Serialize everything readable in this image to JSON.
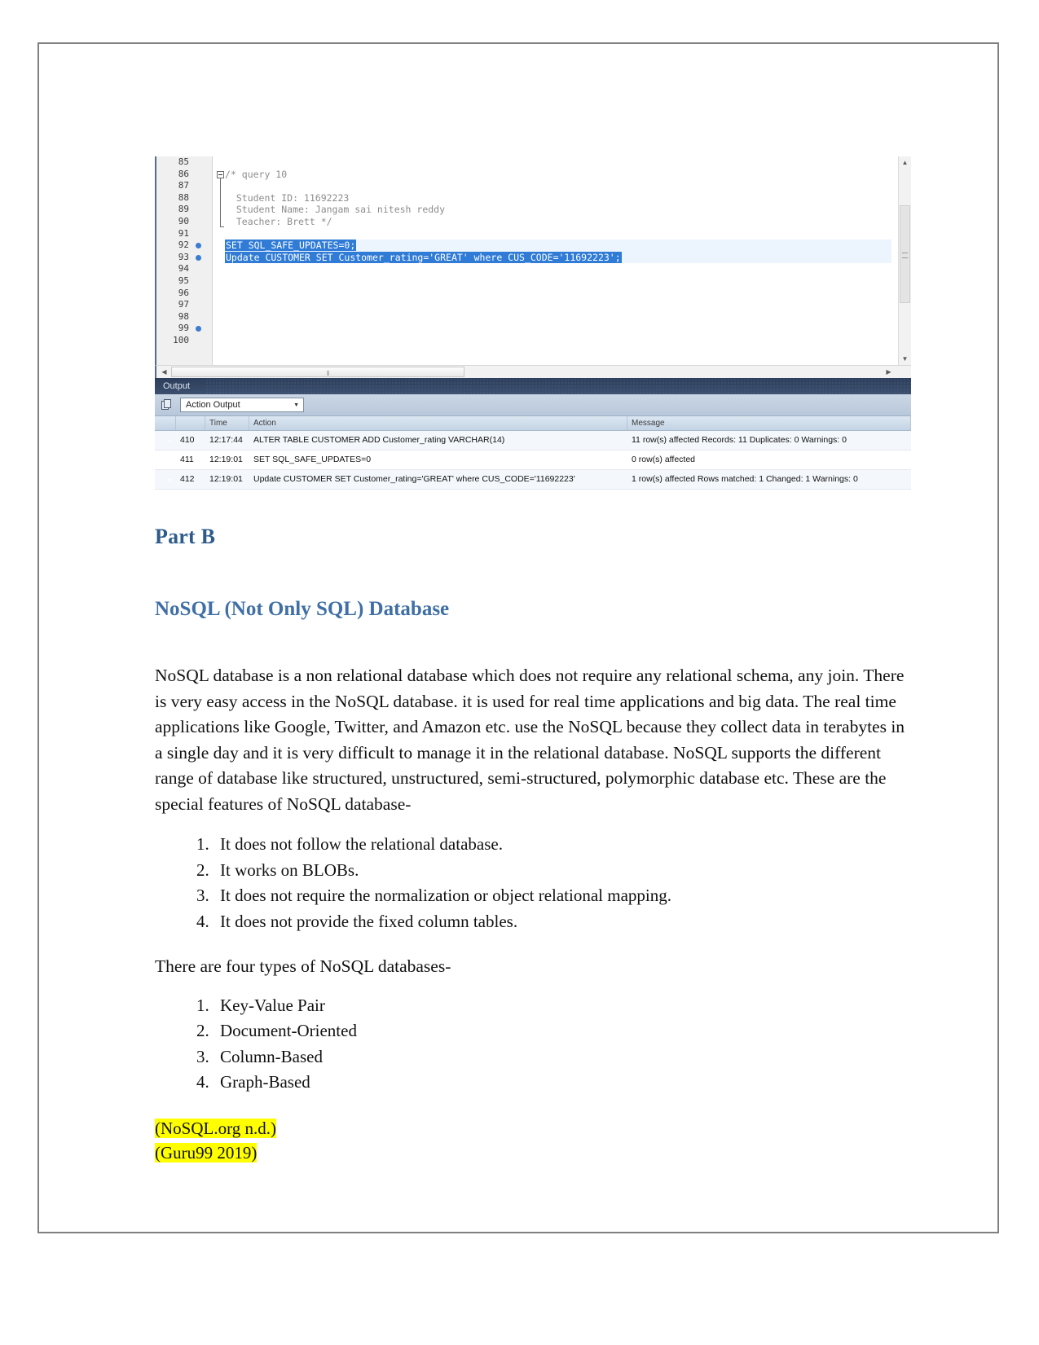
{
  "workbench": {
    "editor": {
      "lines": [
        {
          "num": "85",
          "text": "",
          "bp": false,
          "sel": false
        },
        {
          "num": "86",
          "text": "/* query 10",
          "bp": false,
          "sel": false
        },
        {
          "num": "87",
          "text": "",
          "bp": false,
          "sel": false
        },
        {
          "num": "88",
          "text": "  Student ID: 11692223",
          "bp": false,
          "sel": false
        },
        {
          "num": "89",
          "text": "  Student Name: Jangam sai nitesh reddy",
          "bp": false,
          "sel": false
        },
        {
          "num": "90",
          "text": "  Teacher: Brett */",
          "bp": false,
          "sel": false
        },
        {
          "num": "91",
          "text": "",
          "bp": false,
          "sel": false
        },
        {
          "num": "92",
          "text": "SET SQL_SAFE_UPDATES=0;",
          "bp": true,
          "sel": true
        },
        {
          "num": "93",
          "text": "Update CUSTOMER SET Customer_rating='GREAT' where CUS_CODE='11692223';",
          "bp": true,
          "sel": true
        },
        {
          "num": "94",
          "text": "",
          "bp": false,
          "sel": false
        },
        {
          "num": "95",
          "text": "",
          "bp": false,
          "sel": false
        },
        {
          "num": "96",
          "text": "",
          "bp": false,
          "sel": false
        },
        {
          "num": "97",
          "text": "",
          "bp": false,
          "sel": false
        },
        {
          "num": "98",
          "text": "",
          "bp": false,
          "sel": false
        },
        {
          "num": "99",
          "text": "",
          "bp": true,
          "sel": false
        },
        {
          "num": "100",
          "text": "",
          "bp": false,
          "sel": false
        }
      ]
    },
    "output_panel": {
      "title": "Output",
      "selector_value": "Action Output",
      "columns": [
        "",
        "",
        "Time",
        "Action",
        "Message"
      ],
      "rows": [
        {
          "status": "success",
          "num": "410",
          "time": "12:17:44",
          "action": "ALTER TABLE CUSTOMER ADD Customer_rating VARCHAR(14)",
          "message": "11 row(s) affected Records: 11  Duplicates: 0  Warnings: 0"
        },
        {
          "status": "success",
          "num": "411",
          "time": "12:19:01",
          "action": "SET SQL_SAFE_UPDATES=0",
          "message": "0 row(s) affected"
        },
        {
          "status": "success",
          "num": "412",
          "time": "12:19:01",
          "action": "Update CUSTOMER SET Customer_rating='GREAT' where CUS_CODE='11692223'",
          "message": "1 row(s) affected Rows matched: 1  Changed: 1  Warnings: 0"
        }
      ]
    }
  },
  "document": {
    "part_heading": "Part B",
    "section_heading": "NoSQL (Not Only SQL) Database",
    "intro_paragraph": "NoSQL database is a non relational database which does not require any relational schema, any join. There is very easy access in the NoSQL database. it is used for real time applications and big data. The real time applications like Google, Twitter, and Amazon etc. use the NoSQL because they collect data in terabytes in a single day and it is very difficult to manage it in the relational database. NoSQL supports the different range of database like structured, unstructured, semi-structured, polymorphic database etc. These are the special features of NoSQL database-",
    "features": [
      "It does not follow the relational database.",
      "It works on BLOBs.",
      "It does not require the normalization or object relational mapping.",
      "It does not provide the fixed column tables."
    ],
    "types_intro": "There are four types of NoSQL databases-",
    "types": [
      "Key-Value Pair",
      "Document-Oriented",
      "Column-Based",
      "Graph-Based"
    ],
    "citations": [
      "(NoSQL.org n.d.)",
      "(Guru99 2019)"
    ]
  },
  "colors": {
    "heading_blue": "#2e5c8a",
    "subheading_blue": "#3f6fa5",
    "selection_blue": "#2f7bd6",
    "highlight_yellow": "#ffff00",
    "success_green": "#2aa832"
  }
}
